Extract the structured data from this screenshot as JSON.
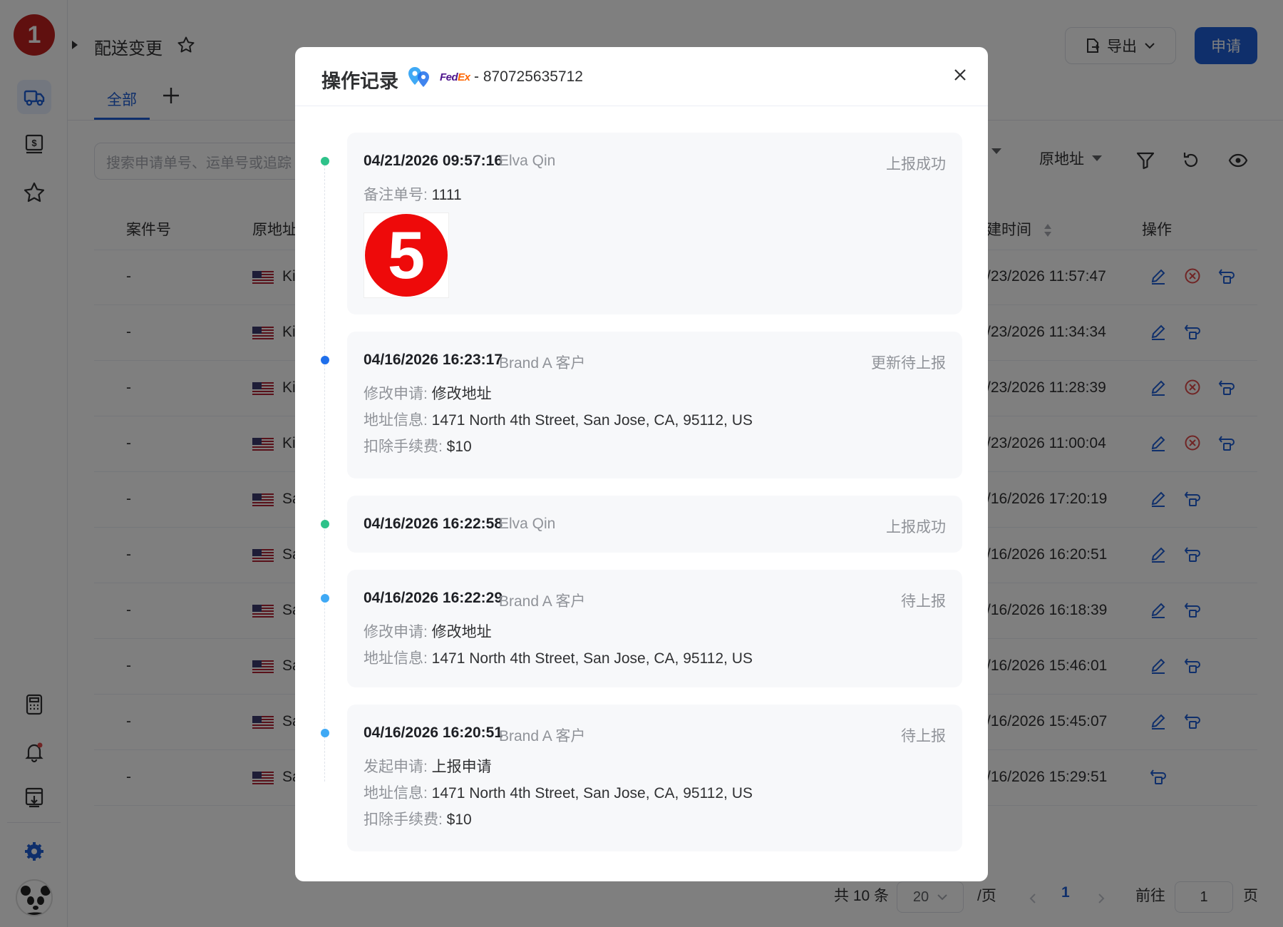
{
  "app": {
    "logo_text": "1",
    "page_title": "配送变更",
    "export_label": "导出",
    "apply_label": "申请",
    "tab_all": "全部",
    "search_placeholder": "搜索申请单号、运单号或追踪",
    "filter_partial_label": "",
    "filter_origin_label": "原地址",
    "colors": {
      "primary": "#1f5fd6",
      "danger": "#e04a4a",
      "logo": "#c0201e"
    }
  },
  "table": {
    "headers": {
      "case_no": "案件号",
      "origin": "原地址",
      "created_time": "建时间",
      "actions": "操作"
    },
    "rows": [
      {
        "case_no": "-",
        "origin": "Ki",
        "created": "/23/2026 11:57:47",
        "has_cancel": true
      },
      {
        "case_no": "-",
        "origin": "Ki",
        "created": "/23/2026 11:34:34",
        "has_cancel": false
      },
      {
        "case_no": "-",
        "origin": "Ki",
        "created": "/23/2026 11:28:39",
        "has_cancel": true
      },
      {
        "case_no": "-",
        "origin": "Ki",
        "created": "/23/2026 11:00:04",
        "has_cancel": true
      },
      {
        "case_no": "-",
        "origin": "Sa",
        "created": "/16/2026 17:20:19",
        "has_cancel": false
      },
      {
        "case_no": "-",
        "origin": "Sa",
        "created": "/16/2026 16:20:51",
        "has_cancel": false
      },
      {
        "case_no": "-",
        "origin": "Sa",
        "created": "/16/2026 16:18:39",
        "has_cancel": false
      },
      {
        "case_no": "-",
        "origin": "Sa",
        "created": "/16/2026 15:46:01",
        "has_cancel": false
      },
      {
        "case_no": "-",
        "origin": "Sa",
        "created": "/16/2026 15:45:07",
        "has_cancel": false
      },
      {
        "case_no": "-",
        "origin": "Sa",
        "created": "/16/2026 15:29:51",
        "has_cancel": false
      }
    ]
  },
  "pagination": {
    "total": "共 10 条",
    "page_size": "20",
    "per_page": "/页",
    "current": "1",
    "goto_label": "前往",
    "goto_value": "1",
    "page_suffix": "页"
  },
  "modal": {
    "title": "操作记录",
    "carrier_fed": "Fed",
    "carrier_ex": "Ex",
    "tracking": "- 870725635712",
    "records": [
      {
        "time": "04/21/2026 09:57:16",
        "user": "Elva Qin",
        "status": "上报成功",
        "dot_color": "#2ec28a",
        "lines": [
          {
            "label": "备注单号: ",
            "value": "1111"
          }
        ],
        "image_text": "5"
      },
      {
        "time": "04/16/2026 16:23:17",
        "user": "Brand A 客户",
        "status": "更新待上报",
        "dot_color": "#1f6feb",
        "lines": [
          {
            "label": "修改申请: ",
            "value": "修改地址"
          },
          {
            "label": "地址信息: ",
            "value": "1471 North 4th Street, San Jose, CA, 95112, US"
          },
          {
            "label": "扣除手续费: ",
            "value": "$10"
          }
        ]
      },
      {
        "time": "04/16/2026 16:22:58",
        "user": "Elva Qin",
        "status": "上报成功",
        "dot_color": "#2ec28a",
        "lines": []
      },
      {
        "time": "04/16/2026 16:22:29",
        "user": "Brand A 客户",
        "status": "待上报",
        "dot_color": "#3fa9f5",
        "lines": [
          {
            "label": "修改申请: ",
            "value": "修改地址"
          },
          {
            "label": "地址信息: ",
            "value": "1471 North 4th Street, San Jose, CA, 95112, US"
          }
        ]
      },
      {
        "time": "04/16/2026 16:20:51",
        "user": "Brand A 客户",
        "status": "待上报",
        "dot_color": "#3fa9f5",
        "lines": [
          {
            "label": "发起申请: ",
            "value": "上报申请"
          },
          {
            "label": "地址信息: ",
            "value": "1471 North 4th Street, San Jose, CA, 95112, US"
          },
          {
            "label": "扣除手续费: ",
            "value": "$10"
          }
        ]
      }
    ]
  }
}
